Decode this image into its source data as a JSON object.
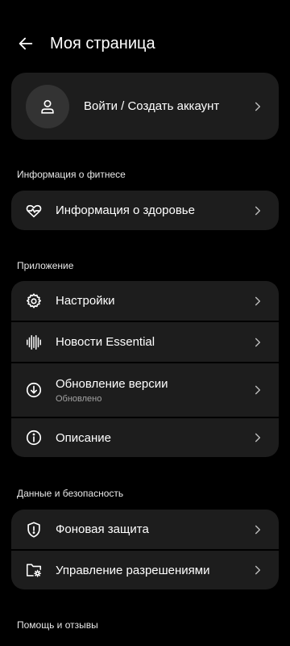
{
  "header": {
    "title": "Моя страница",
    "back_icon": "arrow-left-icon"
  },
  "account": {
    "label": "Войти / Создать аккаунт",
    "avatar_icon": "person-icon"
  },
  "sections": [
    {
      "title": "Информация о фитнесе",
      "items": [
        {
          "label": "Информация о здоровье",
          "icon": "heart-pulse-icon"
        }
      ]
    },
    {
      "title": "Приложение",
      "items": [
        {
          "label": "Настройки",
          "icon": "gear-icon"
        },
        {
          "label": "Новости Essential",
          "icon": "sound-wave-icon"
        },
        {
          "label": "Обновление версии",
          "sublabel": "Обновлено",
          "icon": "download-circle-icon"
        },
        {
          "label": "Описание",
          "icon": "info-icon"
        }
      ]
    },
    {
      "title": "Данные и безопасность",
      "items": [
        {
          "label": "Фоновая защита",
          "icon": "shield-icon"
        },
        {
          "label": "Управление разрешениями",
          "icon": "folder-gear-icon"
        }
      ]
    },
    {
      "title": "Помощь и отзывы",
      "items": []
    }
  ],
  "colors": {
    "background": "#000000",
    "card": "#1d1d1d",
    "avatar_bg": "#333333",
    "text": "#ffffff",
    "subtext": "#a3a3a3"
  }
}
